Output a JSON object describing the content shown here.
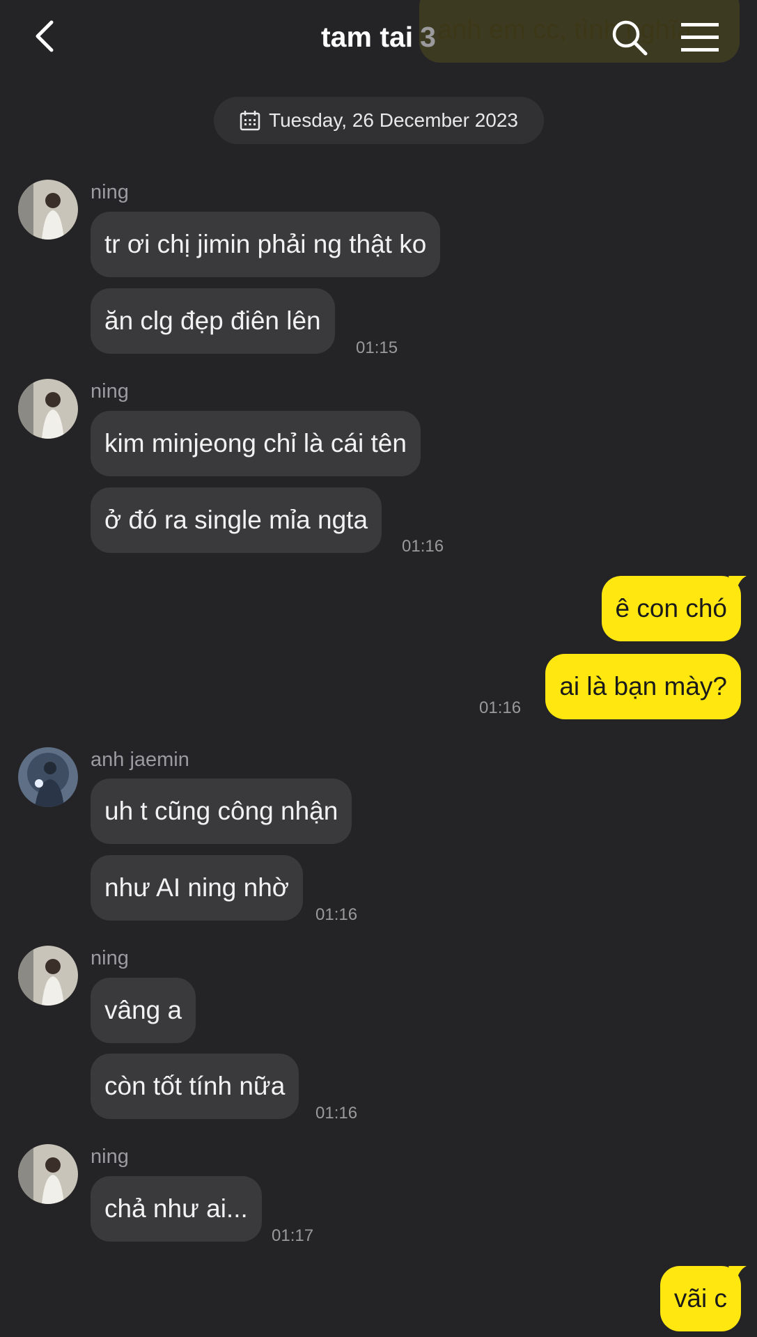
{
  "header": {
    "title": "tam tai",
    "member_count": "3",
    "pinned_preview": "anh em cc, tình nghĩa..."
  },
  "date_chip": {
    "label": "Tuesday, 26 December 2023"
  },
  "messages": [
    {
      "sender": "ning",
      "bubbles": [
        "tr ơi chị jimin phải ng thật ko",
        "ăn clg đẹp điên lên"
      ],
      "time": "01:15"
    },
    {
      "sender": "ning",
      "bubbles": [
        "kim minjeong chỉ là cái tên",
        "ở đó ra single mỉa ngta"
      ],
      "time": "01:16"
    },
    {
      "sender": "me",
      "bubbles": [
        "ê con chó",
        "ai là bạn mày?"
      ],
      "time": "01:16"
    },
    {
      "sender": "anh jaemin",
      "bubbles": [
        "uh t cũng công nhận",
        "như AI ning nhờ"
      ],
      "time": "01:16"
    },
    {
      "sender": "ning",
      "bubbles": [
        "vâng a",
        "còn tốt tính nữa"
      ],
      "time": "01:16"
    },
    {
      "sender": "ning",
      "bubbles": [
        "chả như ai..."
      ],
      "time": "01:17"
    },
    {
      "sender": "me",
      "bubbles": [
        "vãi c"
      ],
      "time": ""
    }
  ],
  "icons": {
    "back": "chevron-left-icon",
    "search": "search-icon",
    "menu": "hamburger-menu-icon",
    "date": "calendar-icon"
  },
  "colors": {
    "background": "#242426",
    "incoming_bubble": "#3a3a3c",
    "outgoing_bubble": "#ffe70f"
  }
}
